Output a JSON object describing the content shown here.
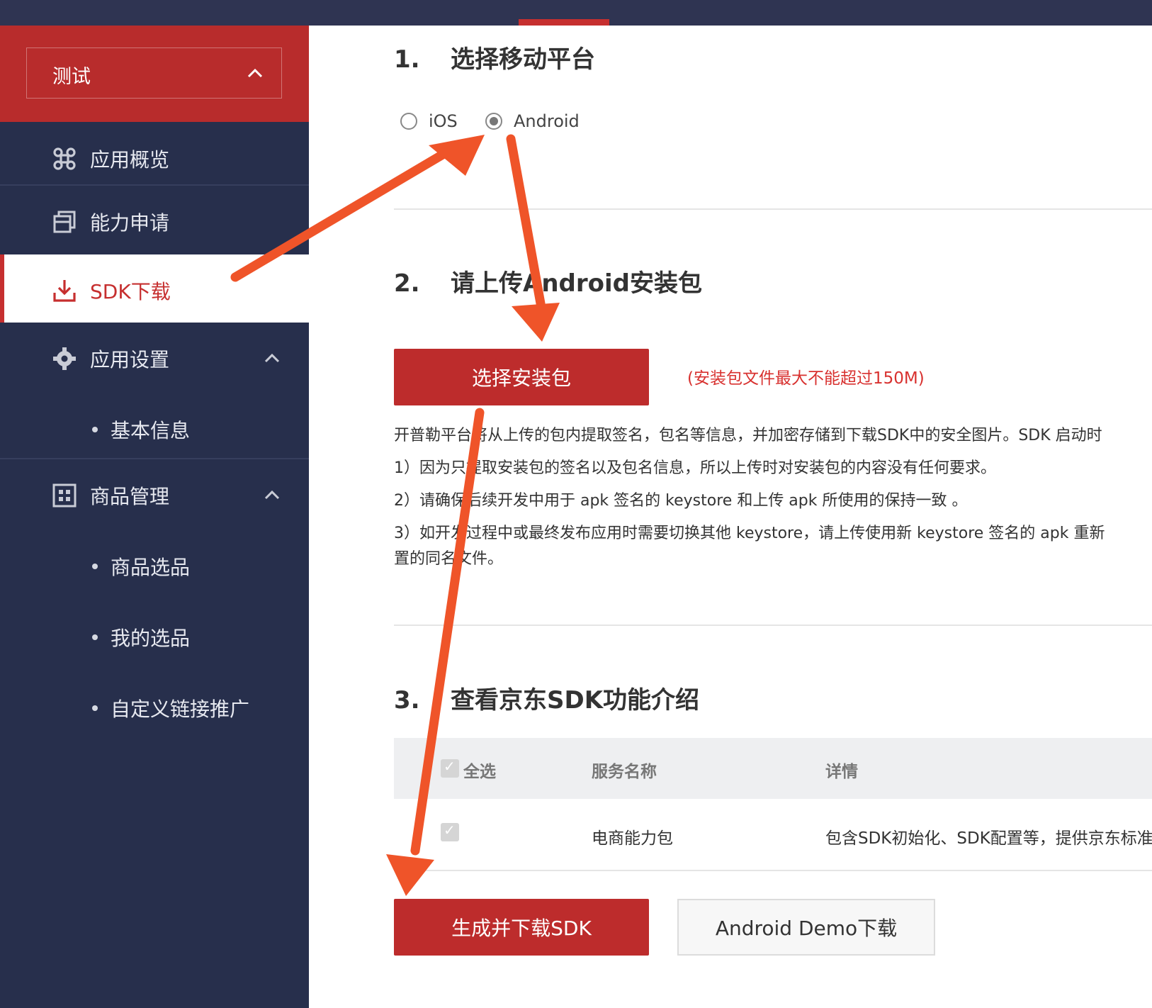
{
  "sidebar": {
    "app_name": "测试",
    "items": [
      {
        "label": "应用概览",
        "icon": "command-icon"
      },
      {
        "label": "能力申请",
        "icon": "window-icon"
      },
      {
        "label": "SDK下载",
        "icon": "download-icon"
      },
      {
        "label": "应用设置",
        "icon": "gear-icon"
      },
      {
        "label": "商品管理",
        "icon": "grid-icon"
      }
    ],
    "sub_items": {
      "settings": [
        "基本信息"
      ],
      "goods": [
        "商品选品",
        "我的选品",
        "自定义链接推广"
      ]
    }
  },
  "step1": {
    "num": "1.",
    "title": "选择移动平台",
    "options": [
      {
        "label": "iOS",
        "checked": false
      },
      {
        "label": "Android",
        "checked": true
      }
    ]
  },
  "step2": {
    "num": "2.",
    "title": "请上传Android安装包",
    "button": "选择安装包",
    "size_note": "(安装包文件最大不能超过150M)",
    "desc": [
      "开普勒平台将从上传的包内提取签名，包名等信息，并加密存储到下载SDK中的安全图片。SDK 启动时",
      "1）因为只提取安装包的签名以及包名信息，所以上传时对安装包的内容没有任何要求。",
      "2）请确保后续开发中用于 apk 签名的 keystore 和上传 apk 所使用的保持一致 。",
      "3）如开发过程中或最终发布应用时需要切换其他 keystore，请上传使用新 keystore 签名的 apk 重新",
      "置的同名文件。"
    ]
  },
  "step3": {
    "num": "3.",
    "title": "查看京东SDK功能介绍",
    "table": {
      "headers": [
        "全选",
        "服务名称",
        "详情"
      ],
      "rows": [
        {
          "name": "电商能力包",
          "detail": "包含SDK初始化、SDK配置等，提供京东标准"
        }
      ]
    }
  },
  "actions": {
    "generate": "生成并下载SDK",
    "demo": "Android Demo下载"
  },
  "colors": {
    "brand_red": "#bd2c2c",
    "sidebar_bg": "#272f4c",
    "arrow": "#ef5429"
  }
}
